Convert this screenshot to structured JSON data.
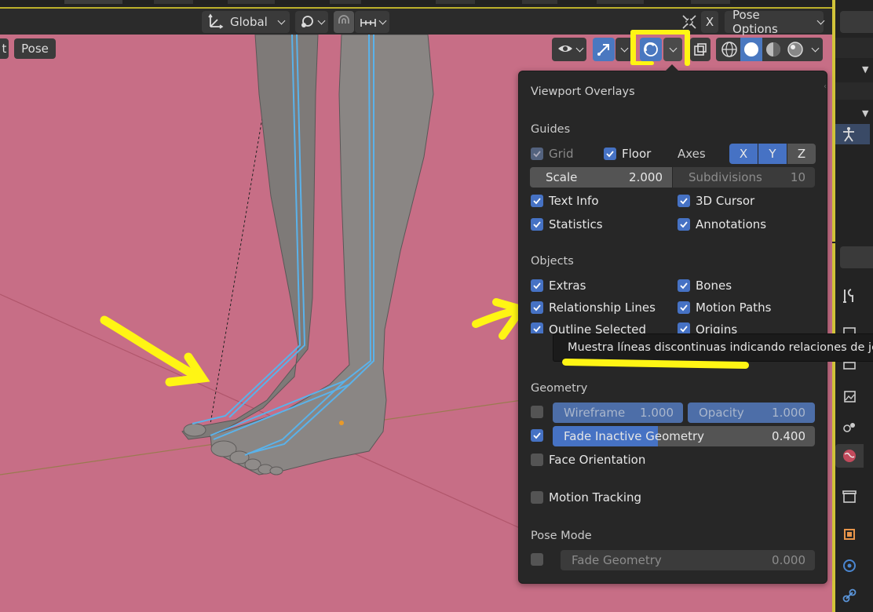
{
  "header": {
    "transform_orientation": "Global",
    "close_label": "X",
    "pose_options_label": "Pose Options"
  },
  "viewport_header": {
    "mode_tab_partial": "t",
    "pose_menu": "Pose"
  },
  "overlays": {
    "title": "Viewport Overlays",
    "guides": {
      "section": "Guides",
      "grid": "Grid",
      "floor": "Floor",
      "axes_label": "Axes",
      "axis_x": "X",
      "axis_y": "Y",
      "axis_z": "Z",
      "scale_label": "Scale",
      "scale_value": "2.000",
      "subdivisions_label": "Subdivisions",
      "subdivisions_value": "10",
      "text_info": "Text Info",
      "cursor_3d": "3D Cursor",
      "statistics": "Statistics",
      "annotations": "Annotations"
    },
    "objects": {
      "section": "Objects",
      "extras": "Extras",
      "bones": "Bones",
      "relationship_lines": "Relationship Lines",
      "motion_paths": "Motion Paths",
      "outline_selected": "Outline Selected",
      "origins": "Origins"
    },
    "geometry": {
      "section": "Geometry",
      "wireframe_label": "Wireframe",
      "wireframe_value": "1.000",
      "opacity_label": "Opacity",
      "opacity_value": "1.000",
      "fade_inactive_label": "Fade Inactive Geometry",
      "fade_inactive_value": "0.400",
      "fade_inactive_fraction": 0.4,
      "face_orientation": "Face Orientation"
    },
    "motion_tracking": "Motion Tracking",
    "pose_mode": {
      "section": "Pose Mode",
      "fade_geometry_label": "Fade Geometry",
      "fade_geometry_value": "0.000"
    }
  },
  "tooltip": {
    "text": "Muestra líneas discontinuas indicando relaciones de jerarquía"
  },
  "colors": {
    "viewport_bg": "#c76e86",
    "accent_blue": "#4672c4",
    "highlight_yellow": "#fff514",
    "panel_bg": "#272727"
  }
}
